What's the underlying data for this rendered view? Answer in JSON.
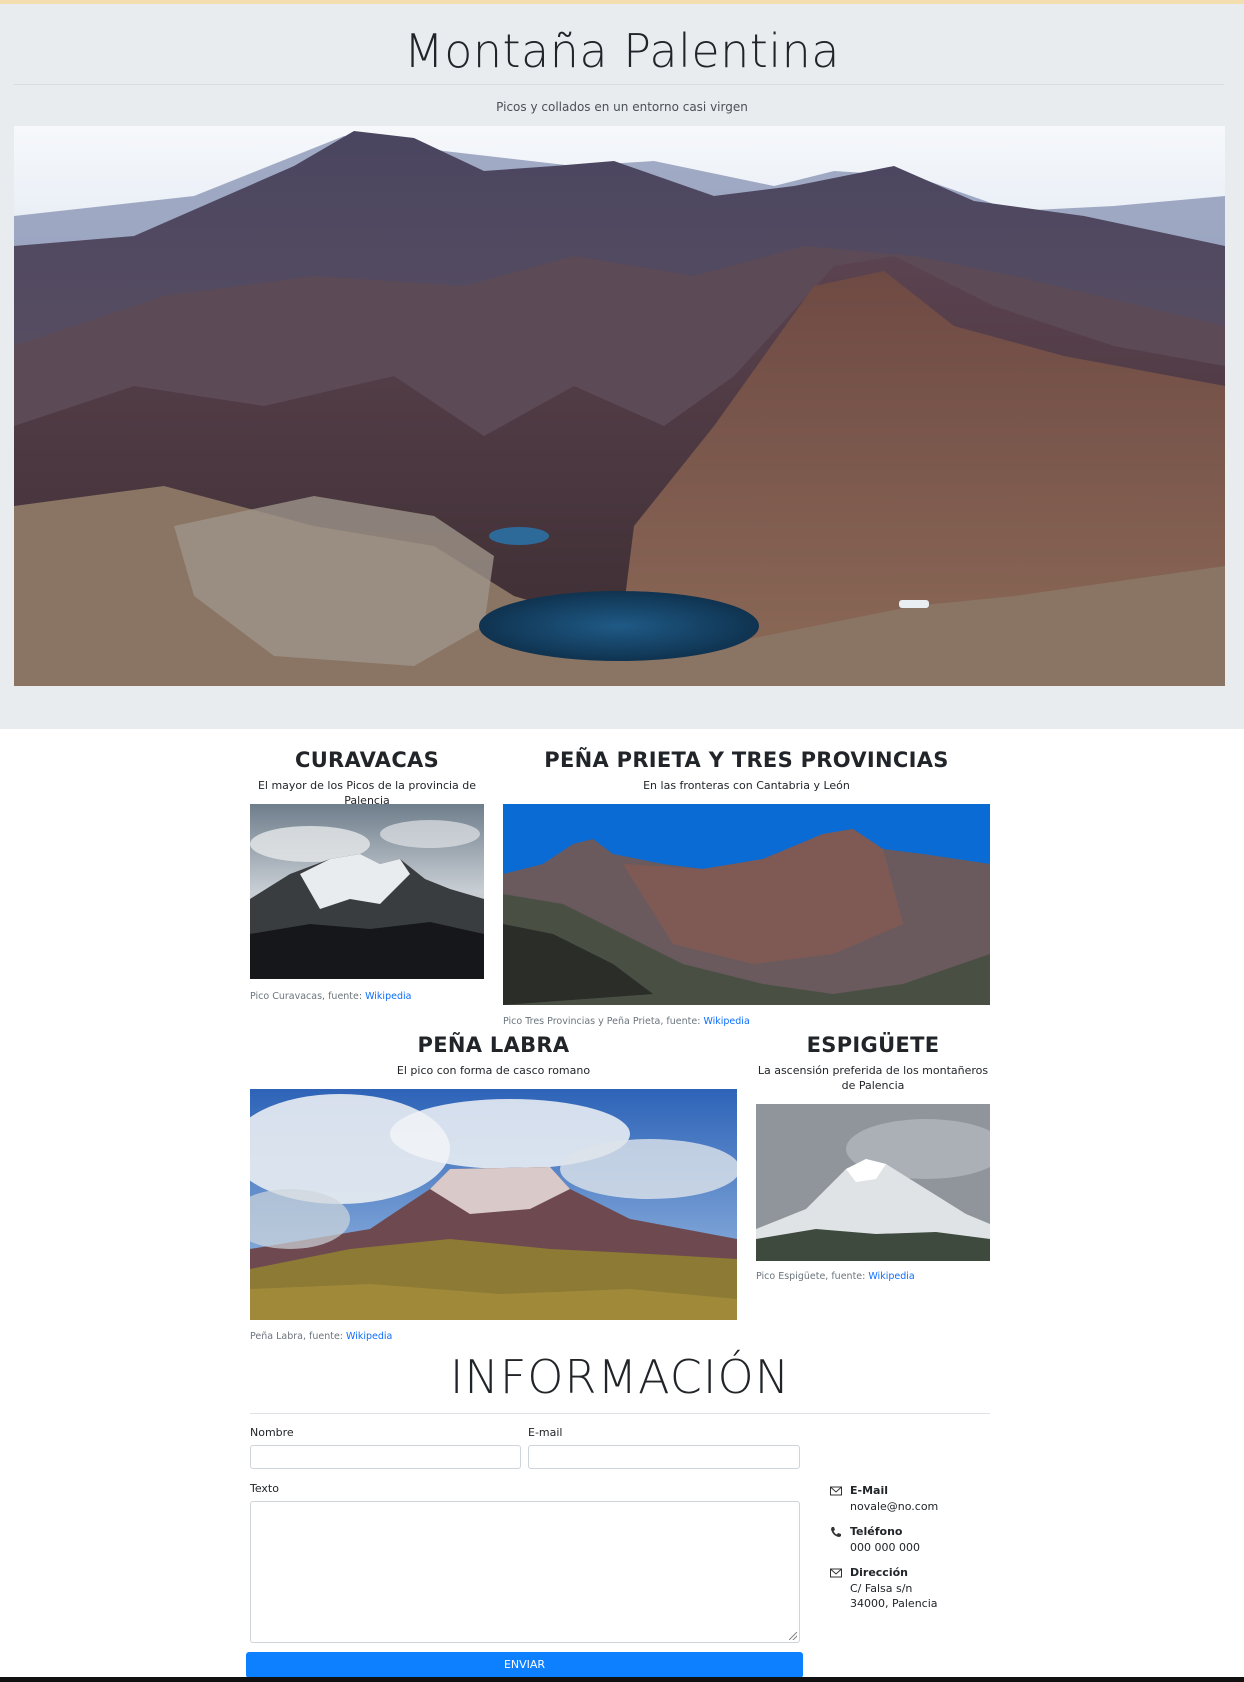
{
  "hero": {
    "title": "Montaña Palentina",
    "subtitle": "Picos y collados en un entorno casi virgen"
  },
  "cards": [
    {
      "title": "CURAVACAS",
      "lead": "El mayor de los Picos de la provincia de Palencia",
      "caption": "Pico Curavacas, fuente: ",
      "link": "Wikipedia"
    },
    {
      "title": "PEÑA PRIETA Y TRES PROVINCIAS",
      "lead": "En las fronteras con Cantabria y León",
      "caption": "Pico Tres Provincias y Peña Prieta, fuente: ",
      "link": "Wikipedia"
    },
    {
      "title": "PEÑA LABRA",
      "lead": "El pico con forma de casco romano",
      "caption": "Peña Labra, fuente: ",
      "link": "Wikipedia"
    },
    {
      "title": "ESPIGÜETE",
      "lead": "La ascensión preferida de los montañeros de Palencia",
      "caption": "Pico Espigüete, fuente: ",
      "link": "Wikipedia"
    }
  ],
  "info": {
    "title": "INFORMACIÓN",
    "name_label": "Nombre",
    "email_label": "E-mail",
    "text_label": "Texto",
    "send_label": "ENVIAR"
  },
  "contact": {
    "email_title": "E-Mail",
    "email_value": "novale@no.com",
    "phone_title": "Teléfono",
    "phone_value": "000 000 000",
    "address_title": "Dirección",
    "address_line1": "C/ Falsa s/n",
    "address_line2": "34000, Palencia"
  },
  "colors": {
    "jumbotron_bg": "#e9ecef",
    "primary": "#0d80ff",
    "link": "#0d6efd"
  }
}
